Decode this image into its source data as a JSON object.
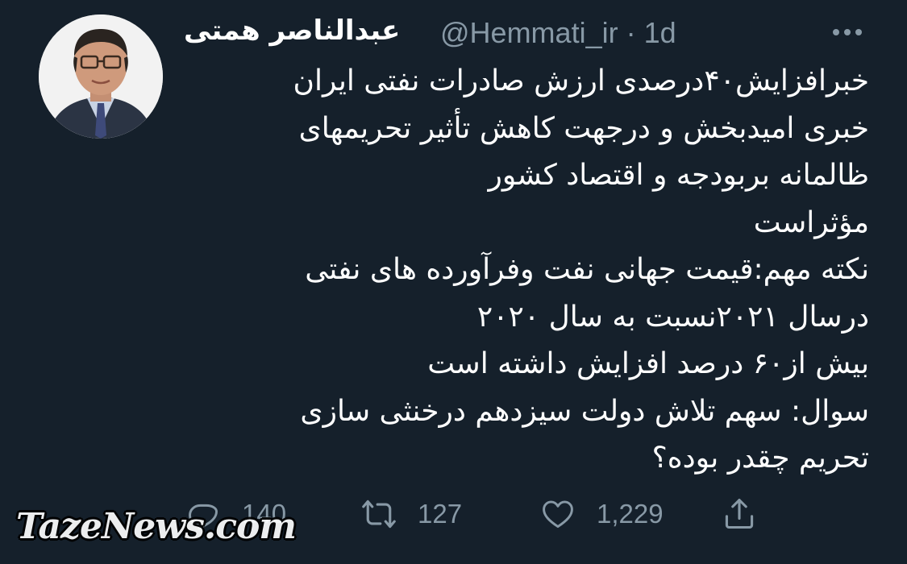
{
  "tweet": {
    "display_name": "عبدالناصر همتی",
    "handle": "@Hemmati_ir",
    "separator": "·",
    "time": "1d",
    "avatar_icon": "profile-photo-man-glasses-suit",
    "more_icon": "more-horizontal-icon",
    "lines": [
      "خبرافزایش۴۰درصدی ارزش صادرات نفتی ایران",
      "خبری امیدبخش و درجهت کاهش تأثیر تحریمهای",
      "ظالمانه بربودجه و اقتصاد کشور",
      "مؤثراست",
      "نکته مهم:قیمت جهانی نفت وفرآورده های نفتی",
      "درسال ۲۰۲۱نسبت به سال ۲۰۲۰",
      "بیش از۶۰ درصد افزایش داشته است",
      "سوال: سهم تلاش دولت سیزدهم درخنثی سازی",
      "تحریم چقدر بوده؟"
    ]
  },
  "actions": {
    "reply": {
      "icon": "reply-icon",
      "count": "140"
    },
    "retweet": {
      "icon": "retweet-icon",
      "count": "127"
    },
    "like": {
      "icon": "heart-icon",
      "count": "1,229"
    },
    "share": {
      "icon": "share-icon"
    }
  },
  "watermark": "TazeNews.com",
  "colors": {
    "background": "#15202b",
    "text": "#ffffff",
    "secondary": "#8899a6"
  }
}
